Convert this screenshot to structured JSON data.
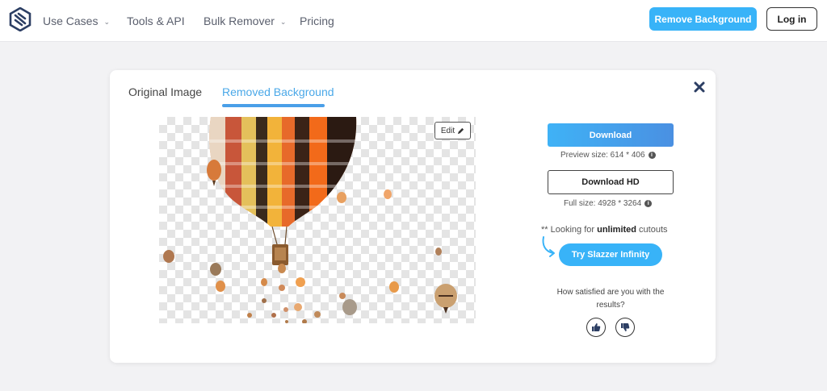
{
  "header": {
    "nav": [
      {
        "label": "Use Cases",
        "dropdown": true
      },
      {
        "label": "Tools & API",
        "dropdown": false
      },
      {
        "label": "Bulk Remover",
        "dropdown": true
      },
      {
        "label": "Pricing",
        "dropdown": false
      }
    ],
    "remove_background_label": "Remove Background",
    "login_label": "Log in"
  },
  "tabs": {
    "original": "Original Image",
    "removed": "Removed Background"
  },
  "preview": {
    "edit_label": "Edit"
  },
  "download": {
    "label": "Download",
    "preview_size_label": "Preview size: 614 * 406",
    "hd_label": "Download HD",
    "full_size_label": "Full size: 4928 * 3264"
  },
  "promo": {
    "prefix": "** Looking for ",
    "highlight": "unlimited",
    "suffix": " cutouts",
    "button_label": "Try Slazzer Infinity"
  },
  "feedback": {
    "question": "How satisfied are you with the results?"
  },
  "colors": {
    "accent": "#38b3f8",
    "tab_active": "#4a9fe8",
    "navy_icon": "#2c3e63"
  },
  "icons": [
    "logo-icon",
    "chevron-down-icon",
    "close-icon",
    "pencil-icon",
    "info-icon",
    "curved-arrow-icon",
    "thumbs-up-icon",
    "thumbs-down-icon"
  ]
}
